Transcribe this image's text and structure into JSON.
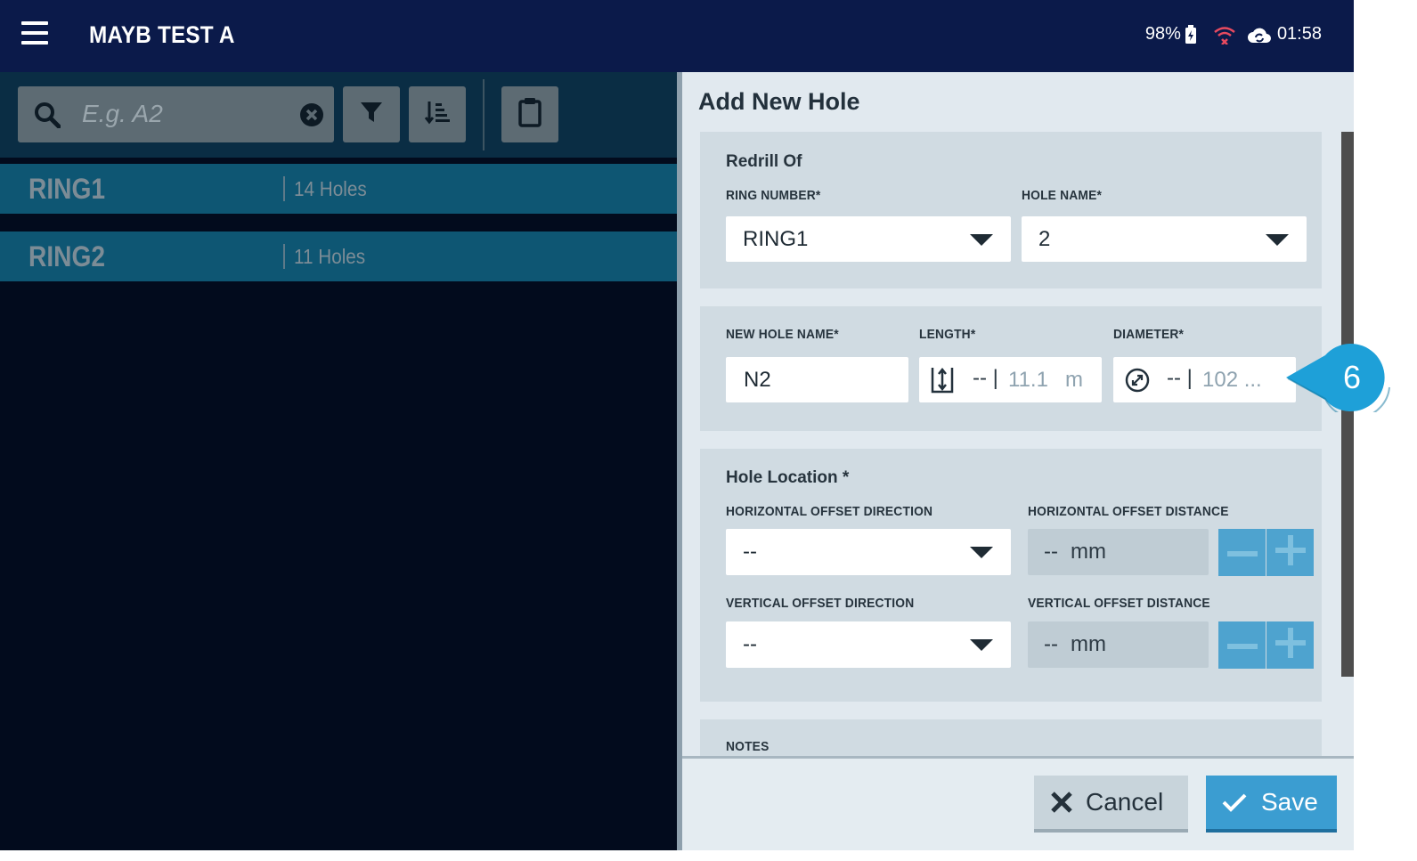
{
  "app": {
    "title": "MAYB TEST A"
  },
  "status_bar": {
    "battery": "98%",
    "time": "01:58"
  },
  "search": {
    "placeholder": "E.g. A2"
  },
  "rings": [
    {
      "name": "RING1",
      "count": "14 Holes"
    },
    {
      "name": "RING2",
      "count": "11 Holes"
    }
  ],
  "form": {
    "title": "Add New Hole",
    "redrill": {
      "title": "Redrill Of",
      "ring_label": "RING NUMBER*",
      "ring_value": "RING1",
      "hole_label": "HOLE NAME*",
      "hole_value": "2"
    },
    "hole": {
      "name_label": "NEW HOLE NAME*",
      "name_value": "N2",
      "length_label": "LENGTH*",
      "length_dash": "-- |",
      "length_value": "11.1",
      "length_unit": "m",
      "diameter_label": "DIAMETER*",
      "diameter_dash": "-- |",
      "diameter_value": "102 ..."
    },
    "location": {
      "title": "Hole Location *",
      "h_dir_label": "HORIZONTAL OFFSET DIRECTION",
      "h_dir_value": "--",
      "h_dist_label": "HORIZONTAL OFFSET DISTANCE",
      "h_dist_dash": "--",
      "h_dist_unit": "mm",
      "v_dir_label": "VERTICAL OFFSET DIRECTION",
      "v_dir_value": "--",
      "v_dist_label": "VERTICAL OFFSET DISTANCE",
      "v_dist_dash": "--",
      "v_dist_unit": "mm"
    },
    "notes_label": "NOTES",
    "cancel_label": "Cancel",
    "save_label": "Save"
  },
  "callout": {
    "number": "6"
  },
  "colors": {
    "topbar": "#0b1a4a",
    "accent": "#3b9dd1",
    "ring_row": "#0e5673",
    "panel": "#e1e9ef"
  },
  "icons": [
    "menu-icon",
    "battery-icon",
    "wifi-off-icon",
    "cloud-sync-icon",
    "search-icon",
    "clear-icon",
    "filter-icon",
    "sort-icon",
    "clipboard-icon",
    "length-icon",
    "diameter-icon",
    "minus-icon",
    "plus-icon",
    "close-icon",
    "check-icon"
  ]
}
